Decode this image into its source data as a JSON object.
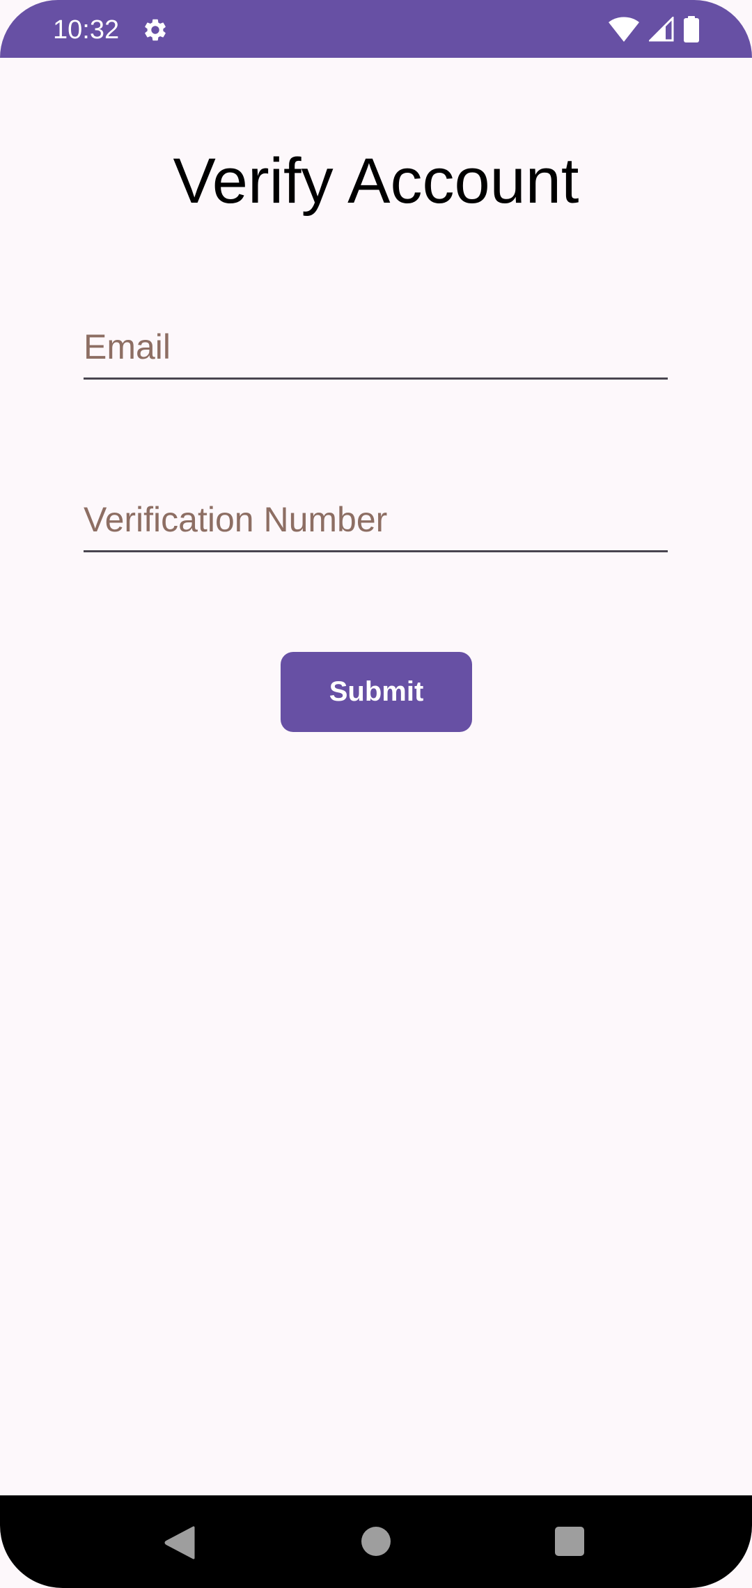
{
  "status_bar": {
    "time": "10:32",
    "color": "#6750a4",
    "icons": [
      "settings-icon",
      "wifi-icon",
      "signal-icon",
      "battery-icon"
    ]
  },
  "page": {
    "title": "Verify Account"
  },
  "form": {
    "email_placeholder": "Email",
    "email_value": "",
    "verification_placeholder": "Verification Number",
    "verification_value": "",
    "submit_label": "Submit"
  },
  "nav_bar": {
    "icons": [
      "back-icon",
      "home-icon",
      "recents-icon"
    ]
  },
  "colors": {
    "accent": "#6750a4",
    "background": "#fdf8fb",
    "placeholder": "#8d6e63"
  }
}
